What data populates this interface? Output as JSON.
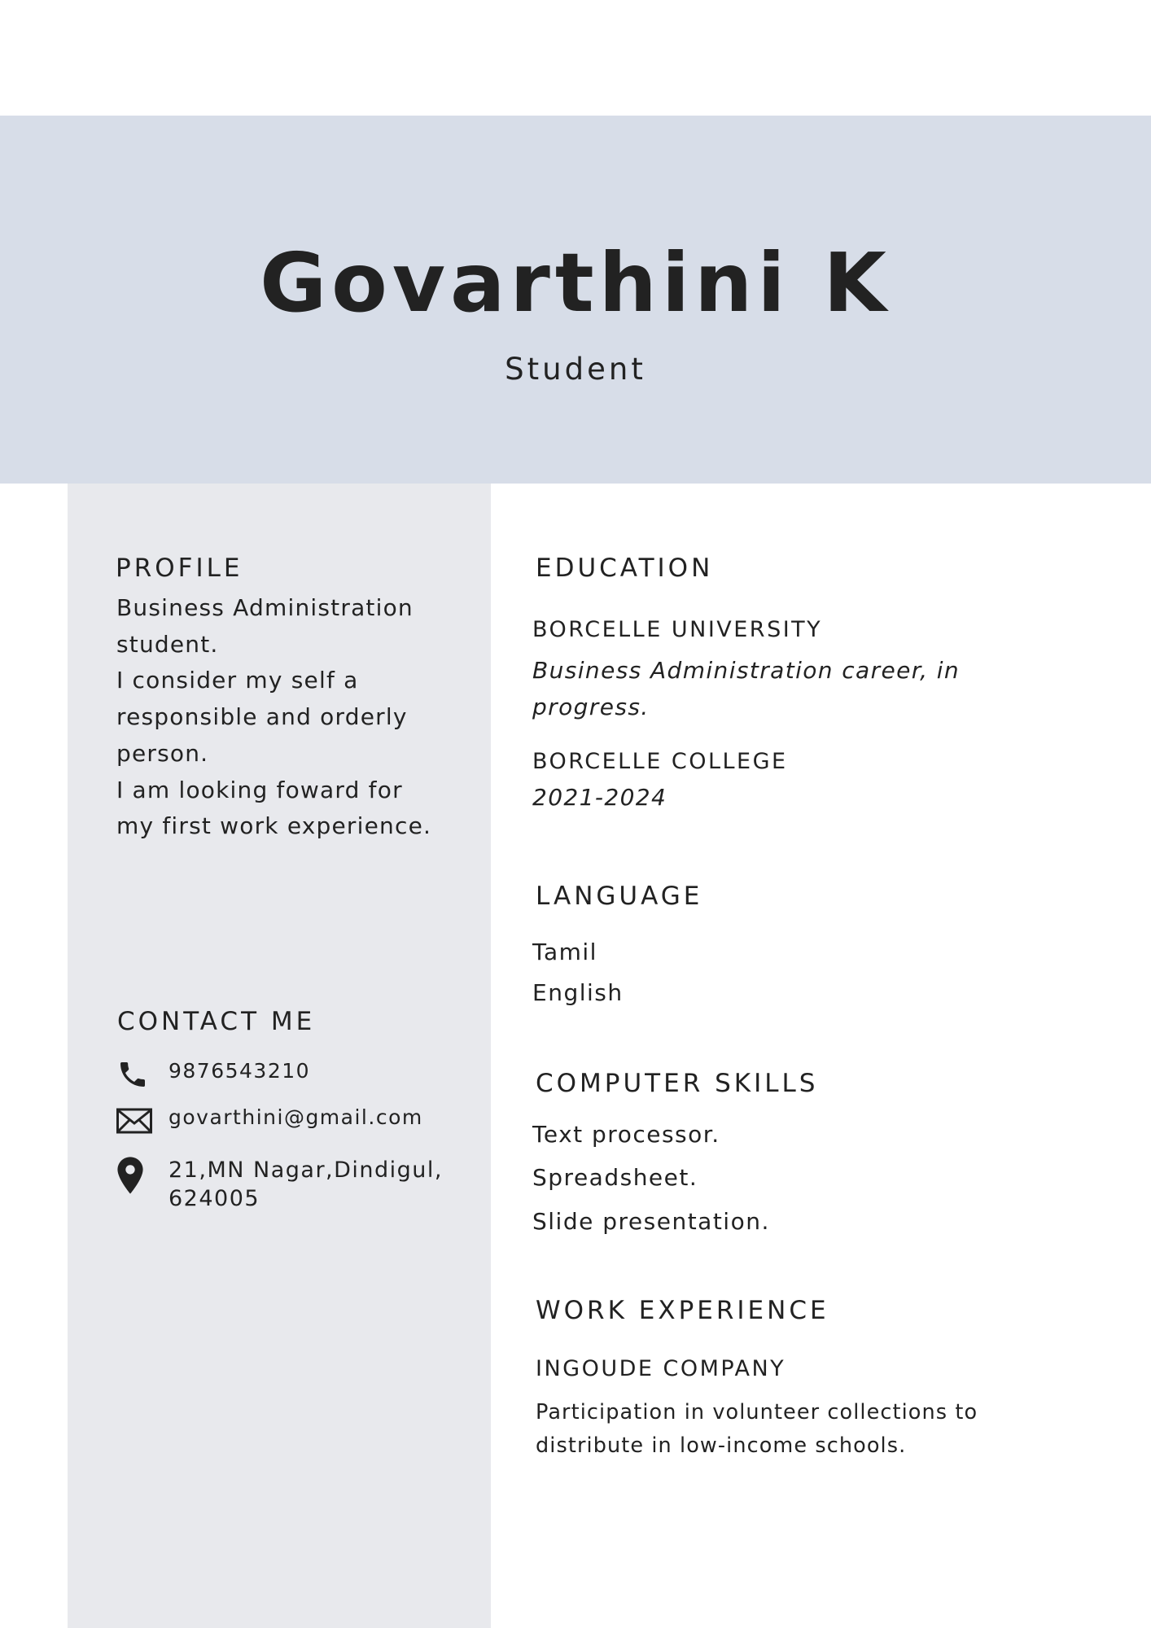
{
  "header": {
    "name": "Govarthini K",
    "role": "Student"
  },
  "profile": {
    "title": "PROFILE",
    "lines": [
      "Business Administration",
      "student.",
      "I consider my self a",
      "responsible and orderly",
      "person.",
      "I am looking foward for",
      "my first work experience."
    ]
  },
  "contact": {
    "title": "CONTACT ME",
    "phone": "9876543210",
    "email": "govarthini@gmail.com",
    "address_line1": "21,MN Nagar,Dindigul,",
    "address_line2": "624005",
    "icons": [
      "phone-icon",
      "mail-icon",
      "location-pin-icon"
    ]
  },
  "education": {
    "title": "EDUCATION",
    "entries": [
      {
        "institution": "BORCELLE UNIVERSITY",
        "detail_lines": [
          "Business Administration career, in",
          "progress."
        ]
      },
      {
        "institution": "BORCELLE COLLEGE",
        "detail_lines": [
          "2021-2024"
        ]
      }
    ]
  },
  "language": {
    "title": "LANGUAGE",
    "items": [
      "Tamil",
      "English"
    ]
  },
  "computer_skills": {
    "title": "COMPUTER SKILLS",
    "items": [
      "Text processor.",
      "Spreadsheet.",
      "Slide presentation."
    ]
  },
  "work_experience": {
    "title": "WORK EXPERIENCE",
    "company": "INGOUDE COMPANY",
    "description_lines": [
      "Participation in volunteer collections to",
      "distribute in low-income schools."
    ]
  },
  "colors": {
    "header_bg": "#d7dde8",
    "sidebar_bg": "#e8e9ed",
    "text": "#222222"
  }
}
